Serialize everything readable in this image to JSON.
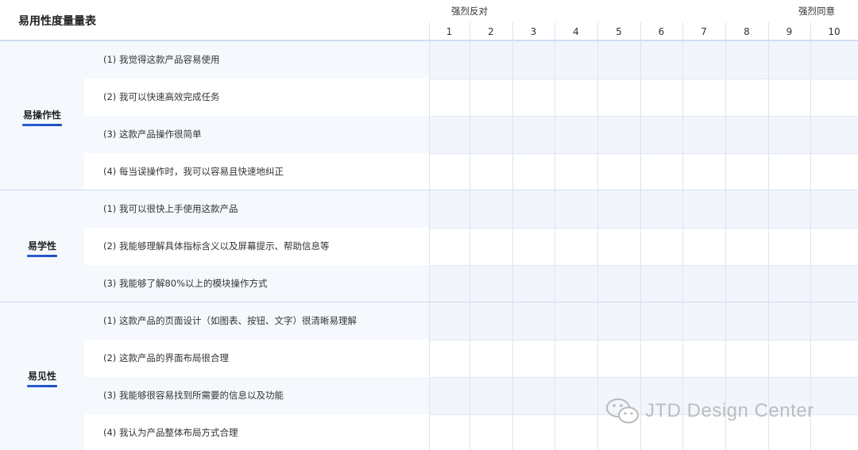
{
  "title": "易用性度量量表",
  "scale": {
    "left_label": "强烈反对",
    "right_label": "强烈同意",
    "columns": [
      "1",
      "2",
      "3",
      "4",
      "5",
      "6",
      "7",
      "8",
      "9",
      "10"
    ]
  },
  "categories": [
    {
      "name": "易操作性",
      "questions": [
        "(1) 我觉得这款产品容易使用",
        "(2) 我可以快速高效完成任务",
        "(3) 这款产品操作很简单",
        "(4) 每当误操作时，我可以容易且快速地纠正"
      ]
    },
    {
      "name": "易学性",
      "questions": [
        "(1) 我可以很快上手使用这款产品",
        "(2) 我能够理解具体指标含义以及屏幕提示、帮助信息等",
        "(3) 我能够了解80%以上的模块操作方式"
      ]
    },
    {
      "name": "易见性",
      "questions": [
        "(1) 这款产品的页面设计（如图表、按钮、文字）很清晰易理解",
        "(2) 这款产品的界面布局很合理",
        "(3) 我能够很容易找到所需要的信息以及功能",
        "(4) 我认为产品整体布局方式合理"
      ]
    }
  ],
  "watermark": {
    "text": "JTD Design Center",
    "icon": "wechat-icon"
  }
}
